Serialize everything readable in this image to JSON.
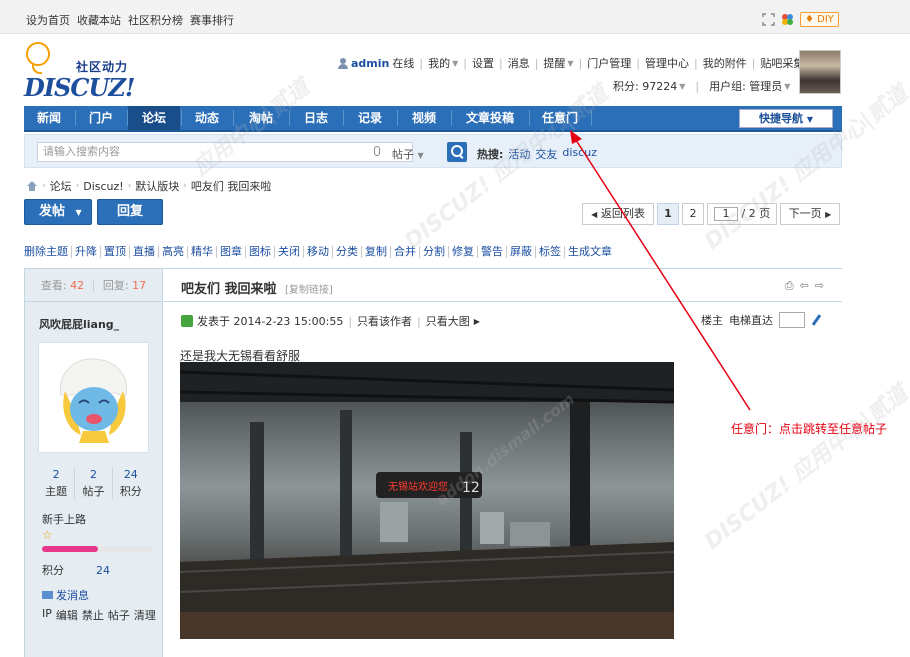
{
  "topbar": {
    "links": [
      "设为首页",
      "收藏本站",
      "社区积分榜",
      "赛事排行"
    ],
    "diy_label": "DIY"
  },
  "logo": {
    "cn": "社区动力",
    "en": "DISCUZ!"
  },
  "userbar": {
    "username": "admin",
    "status": "在线",
    "items": [
      "我的",
      "设置",
      "消息",
      "提醒",
      "门户管理",
      "管理中心",
      "我的附件",
      "贴吧采集",
      "退出"
    ],
    "points_label": "积分: 97224",
    "group_label": "用户组: 管理员"
  },
  "nav": {
    "items": [
      "新闻",
      "门户",
      "论坛",
      "动态",
      "淘帖",
      "日志",
      "记录",
      "视频",
      "文章投稿",
      "任意门"
    ],
    "active": "论坛",
    "quick_nav": "快捷导航"
  },
  "search": {
    "placeholder": "请输入搜索内容",
    "type": "帖子",
    "hot_label": "热搜:",
    "hot_keywords": [
      "活动",
      "交友",
      "discuz"
    ]
  },
  "breadcrumb": [
    "论坛",
    "Discuz!",
    "默认版块",
    "吧友们 我回来啦"
  ],
  "actions": {
    "post": "发帖",
    "reply": "回复"
  },
  "pager": {
    "back": "返回列表",
    "pages": [
      "1",
      "2"
    ],
    "input_value": "1",
    "total": "/ 2 页",
    "next": "下一页"
  },
  "mod_tools": [
    "删除主题",
    "升降",
    "置顶",
    "直播",
    "高亮",
    "精华",
    "图章",
    "图标",
    "关闭",
    "移动",
    "分类",
    "复制",
    "合并",
    "分割",
    "修复",
    "警告",
    "屏蔽",
    "标签",
    "生成文章"
  ],
  "post": {
    "views_label": "查看:",
    "views": "42",
    "replies_label": "回复:",
    "replies": "17",
    "author": "风吹屁屁liang_",
    "stats": [
      {
        "value": "2",
        "label": "主题"
      },
      {
        "value": "2",
        "label": "帖子"
      },
      {
        "value": "24",
        "label": "积分"
      }
    ],
    "rank": "新手上路",
    "progress": 0.5,
    "points_label": "积分",
    "points_value": "24",
    "send_msg": "发消息",
    "admin_links": [
      "IP",
      "编辑",
      "禁止",
      "帖子",
      "清理"
    ],
    "title": "吧友们 我回来啦",
    "copy_link": "[复制链接]",
    "published": "发表于 2014-2-23 15:00:55",
    "only_author": "只看该作者",
    "view_large": "只看大图",
    "floor": "楼主",
    "elevator": "电梯直达",
    "body": "还是我大无锡看看舒服",
    "sign_text": "无锡站欢迎您",
    "sign_num": "12"
  },
  "watermark": {
    "brand": "DISCUZ!",
    "text": "应用中心|贰道",
    "site": "addon.dismall.com"
  },
  "annotation": "任意门：点击跳转至任意帖子"
}
